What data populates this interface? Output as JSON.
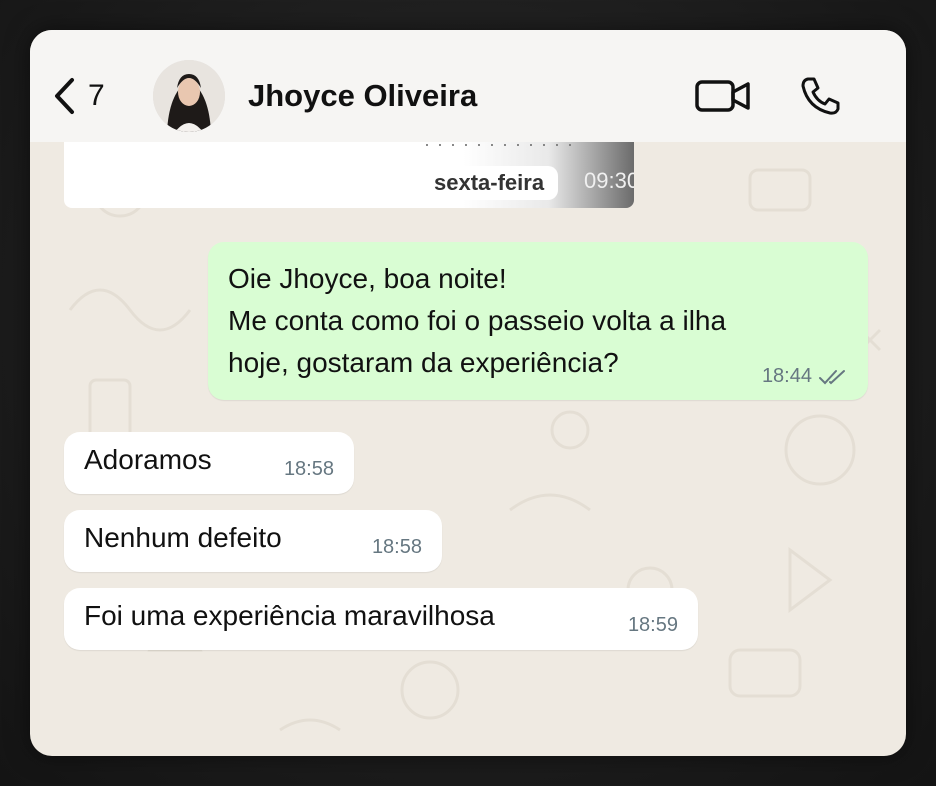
{
  "header": {
    "back_count": "7",
    "contact_name": "Jhoyce Oliveira"
  },
  "date_separator": {
    "label": "sexta-feira",
    "faded_time": "09:30"
  },
  "messages": [
    {
      "direction": "outgoing",
      "lines": [
        "Oie Jhoyce, boa noite!",
        "Me conta como foi o passeio volta a ilha",
        "hoje, gostaram da experiência?"
      ],
      "time": "18:44",
      "status_icon": "double-check-icon"
    },
    {
      "direction": "incoming",
      "text": "Adoramos",
      "time": "18:58"
    },
    {
      "direction": "incoming",
      "text": "Nenhum defeito",
      "time": "18:58"
    },
    {
      "direction": "incoming",
      "text": "Foi uma experiência maravilhosa",
      "time": "18:59"
    }
  ],
  "icons": {
    "back": "chevron-left-icon",
    "video": "video-camera-icon",
    "call": "phone-icon"
  },
  "colors": {
    "chat_background": "#efeae2",
    "outgoing_bubble": "#d9fdd3",
    "incoming_bubble": "#ffffff",
    "meta_text": "#667781"
  }
}
